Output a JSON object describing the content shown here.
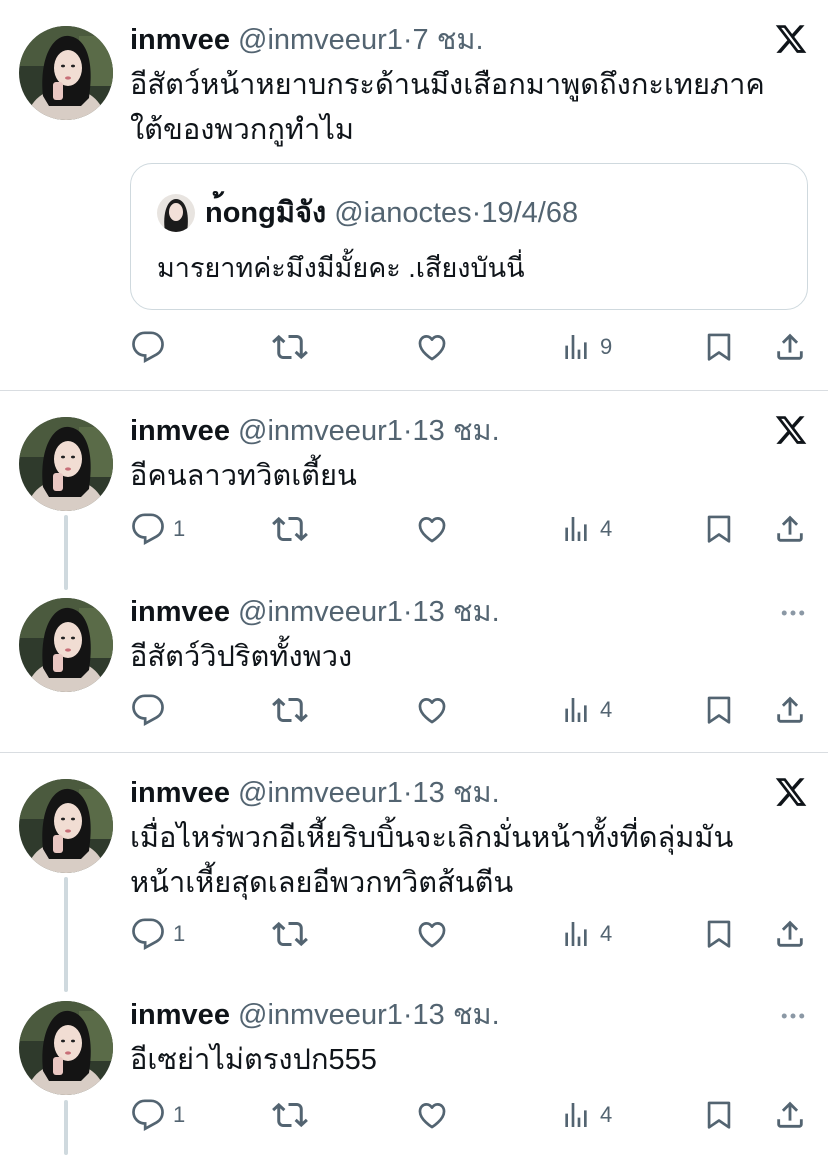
{
  "tweets": [
    {
      "name": "inmvee",
      "handle": "@inmveeur1",
      "dot": "·",
      "time": "7 ชม.",
      "text_lines": [
        "อีสัตว์หน้าหยาบกระด้านมึงเสือกมาพูดถึงกะเทยภาค",
        "ใต้ของพวกกูทำไม"
      ],
      "corner_icon": "x-logo-icon",
      "stats": {
        "replies": "",
        "views": "9"
      },
      "quote": {
        "name": "n้ongมิจัง",
        "handle": "@ianoctes",
        "dot": "·",
        "date": "19/4/68",
        "text": "มารยาทค่ะมึงมีมั้ยคะ .เสียงบันนี่"
      }
    },
    {
      "name": "inmvee",
      "handle": "@inmveeur1",
      "dot": "·",
      "time": "13 ชม.",
      "text_lines": [
        "อีคนลาวทวิตเตี้ยน"
      ],
      "corner_icon": "x-logo-icon",
      "stats": {
        "replies": "1",
        "views": "4"
      }
    },
    {
      "name": "inmvee",
      "handle": "@inmveeur1",
      "dot": "·",
      "time": "13 ชม.",
      "text_lines": [
        "อีสัตว์วิปริตทั้งพวง"
      ],
      "corner_icon": "more-options-icon",
      "stats": {
        "replies": "",
        "views": "4"
      }
    },
    {
      "name": "inmvee",
      "handle": "@inmveeur1",
      "dot": "·",
      "time": "13 ชม.",
      "text_lines": [
        "เมื่อไหร่พวกอีเหี้ยริบบิ้นจะเลิกมั่นหน้าทั้งที่ดลุ่มมัน",
        "หน้าเหี้ยสุดเลยอีพวกทวิตส้นตีน"
      ],
      "corner_icon": "x-logo-icon",
      "stats": {
        "replies": "1",
        "views": "4"
      }
    },
    {
      "name": "inmvee",
      "handle": "@inmveeur1",
      "dot": "·",
      "time": "13 ชม.",
      "text_lines": [
        "อีเซย่าไม่ตรงปก555"
      ],
      "corner_icon": "more-options-icon",
      "stats": {
        "replies": "1",
        "views": "4"
      }
    }
  ],
  "colors": {
    "text": "#0f1419",
    "secondary": "#536471",
    "thread_line": "#cfd9de",
    "border": "#cfd9de"
  },
  "icons": [
    "reply-icon",
    "retweet-icon",
    "like-icon",
    "views-icon",
    "bookmark-icon",
    "share-icon"
  ]
}
